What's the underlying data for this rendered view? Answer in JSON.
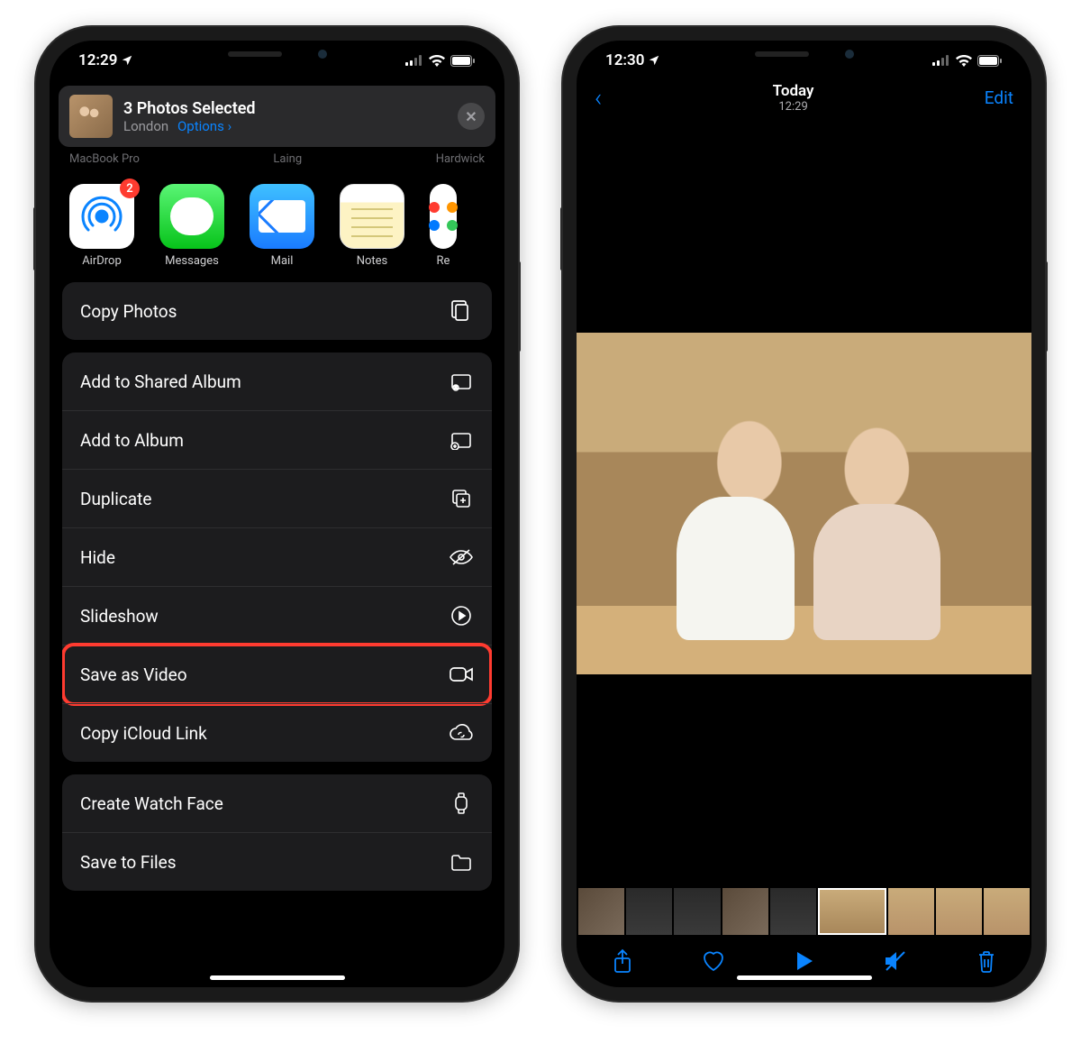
{
  "left": {
    "status_time": "12:29",
    "header": {
      "title": "3 Photos Selected",
      "location": "London",
      "options_label": "Options",
      "close_label": "✕"
    },
    "airdrop_targets": [
      "MacBook Pro",
      "Laing",
      "Hardwick"
    ],
    "apps": [
      {
        "name": "AirDrop",
        "name_key": "airdrop",
        "badge": "2"
      },
      {
        "name": "Messages",
        "name_key": "messages"
      },
      {
        "name": "Mail",
        "name_key": "mail"
      },
      {
        "name": "Notes",
        "name_key": "notes"
      },
      {
        "name": "Re",
        "name_key": "reminders"
      }
    ],
    "actions": {
      "copy_photos": "Copy Photos",
      "add_shared": "Add to Shared Album",
      "add_album": "Add to Album",
      "duplicate": "Duplicate",
      "hide": "Hide",
      "slideshow": "Slideshow",
      "save_video": "Save as Video",
      "icloud_link": "Copy iCloud Link",
      "watch_face": "Create Watch Face",
      "save_files": "Save to Files"
    }
  },
  "right": {
    "status_time": "12:30",
    "nav": {
      "title": "Today",
      "subtitle": "12:29",
      "edit_label": "Edit"
    }
  }
}
